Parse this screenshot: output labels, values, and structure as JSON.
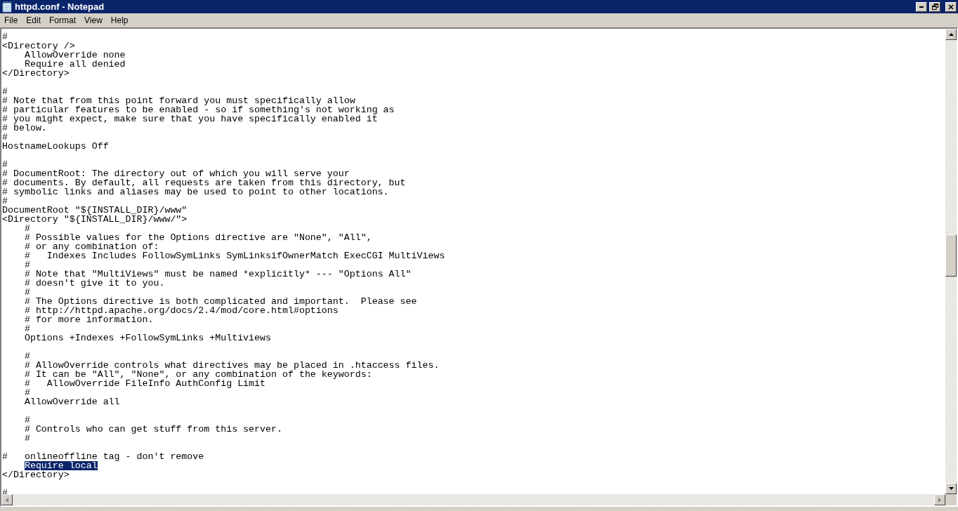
{
  "window": {
    "title": "httpd.conf - Notepad"
  },
  "menu": [
    {
      "label": "File"
    },
    {
      "label": "Edit"
    },
    {
      "label": "Format"
    },
    {
      "label": "View"
    },
    {
      "label": "Help"
    }
  ],
  "lines": [
    {
      "kind": "text",
      "text": "#",
      "selected": false
    },
    {
      "kind": "text",
      "text": "<Directory />",
      "selected": false
    },
    {
      "kind": "text",
      "text": "    AllowOverride none",
      "selected": false
    },
    {
      "kind": "text",
      "text": "    Require all denied",
      "selected": false
    },
    {
      "kind": "text",
      "text": "</Directory>",
      "selected": false
    },
    {
      "kind": "blank",
      "selected": false
    },
    {
      "kind": "text",
      "text": "#",
      "selected": false
    },
    {
      "kind": "text",
      "text": "# Note that from this point forward you must specifically allow",
      "selected": false
    },
    {
      "kind": "text",
      "text": "# particular features to be enabled - so if something's not working as",
      "selected": false
    },
    {
      "kind": "text",
      "text": "# you might expect, make sure that you have specifically enabled it",
      "selected": false
    },
    {
      "kind": "text",
      "text": "# below.",
      "selected": false
    },
    {
      "kind": "text",
      "text": "#",
      "selected": false
    },
    {
      "kind": "text",
      "text": "HostnameLookups Off",
      "selected": false
    },
    {
      "kind": "blank",
      "selected": false
    },
    {
      "kind": "text",
      "text": "#",
      "selected": false
    },
    {
      "kind": "text",
      "text": "# DocumentRoot: The directory out of which you will serve your",
      "selected": false
    },
    {
      "kind": "text",
      "text": "# documents. By default, all requests are taken from this directory, but",
      "selected": false
    },
    {
      "kind": "text",
      "text": "# symbolic links and aliases may be used to point to other locations.",
      "selected": false
    },
    {
      "kind": "text",
      "text": "#",
      "selected": false
    },
    {
      "kind": "text",
      "text": "DocumentRoot \"${INSTALL_DIR}/www\"",
      "selected": false
    },
    {
      "kind": "text",
      "text": "<Directory \"${INSTALL_DIR}/www/\">",
      "selected": false
    },
    {
      "kind": "text",
      "text": "    #",
      "selected": false
    },
    {
      "kind": "text",
      "text": "    # Possible values for the Options directive are \"None\", \"All\",",
      "selected": false
    },
    {
      "kind": "text",
      "text": "    # or any combination of:",
      "selected": false
    },
    {
      "kind": "text",
      "text": "    #   Indexes Includes FollowSymLinks SymLinksifOwnerMatch ExecCGI MultiViews",
      "selected": false
    },
    {
      "kind": "text",
      "text": "    #",
      "selected": false
    },
    {
      "kind": "text",
      "text": "    # Note that \"MultiViews\" must be named *explicitly* --- \"Options All\"",
      "selected": false
    },
    {
      "kind": "text",
      "text": "    # doesn't give it to you.",
      "selected": false
    },
    {
      "kind": "text",
      "text": "    #",
      "selected": false
    },
    {
      "kind": "text",
      "text": "    # The Options directive is both complicated and important.  Please see",
      "selected": false
    },
    {
      "kind": "text",
      "text": "    # http://httpd.apache.org/docs/2.4/mod/core.html#options",
      "selected": false
    },
    {
      "kind": "text",
      "text": "    # for more information.",
      "selected": false
    },
    {
      "kind": "text",
      "text": "    #",
      "selected": false
    },
    {
      "kind": "text",
      "text": "    Options +Indexes +FollowSymLinks +Multiviews",
      "selected": false
    },
    {
      "kind": "blank",
      "selected": false
    },
    {
      "kind": "text",
      "text": "    #",
      "selected": false
    },
    {
      "kind": "text",
      "text": "    # AllowOverride controls what directives may be placed in .htaccess files.",
      "selected": false
    },
    {
      "kind": "text",
      "text": "    # It can be \"All\", \"None\", or any combination of the keywords:",
      "selected": false
    },
    {
      "kind": "text",
      "text": "    #   AllowOverride FileInfo AuthConfig Limit",
      "selected": false
    },
    {
      "kind": "text",
      "text": "    #",
      "selected": false
    },
    {
      "kind": "text",
      "text": "    AllowOverride all",
      "selected": false
    },
    {
      "kind": "blank",
      "selected": false
    },
    {
      "kind": "text",
      "text": "    #",
      "selected": false
    },
    {
      "kind": "text",
      "text": "    # Controls who can get stuff from this server.",
      "selected": false
    },
    {
      "kind": "text",
      "text": "    #",
      "selected": false
    },
    {
      "kind": "blank",
      "selected": false
    },
    {
      "kind": "text",
      "text": "#   onlineoffline tag - don't remove",
      "selected": false
    },
    {
      "kind": "text",
      "text": "    Require local",
      "selected": true
    },
    {
      "kind": "text",
      "text": "</Directory>",
      "selected": false
    },
    {
      "kind": "blank",
      "selected": false
    },
    {
      "kind": "text",
      "text": "#",
      "selected": false
    }
  ]
}
